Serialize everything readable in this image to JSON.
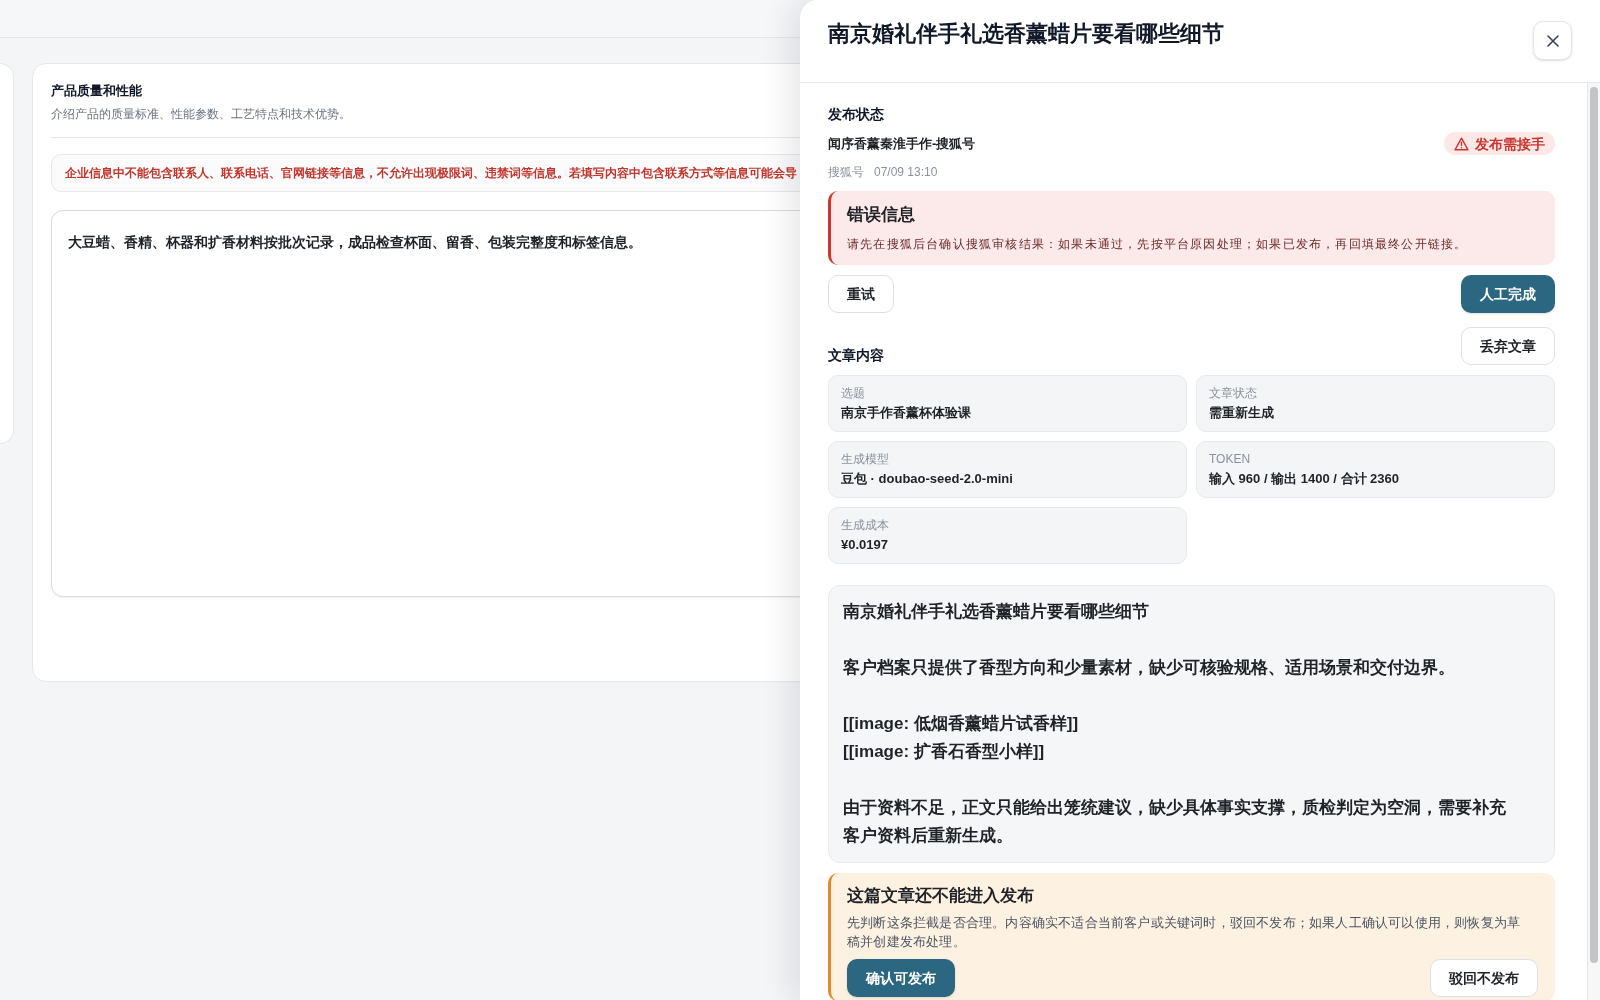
{
  "page": {
    "section": {
      "title": "产品质量和性能",
      "description": "介绍产品的质量标准、性能参数、工艺特点和技术优势。",
      "notice": "企业信息中不能包含联系人、联系电话、官网链接等信息，不允许出现极限词、违禁词等信息。若填写内容中包含联系方式等信息可能会导",
      "field_value": "大豆蜡、香精、杯器和扩香材料按批次记录，成品检查杯面、留香、包装完整度和标签信息。"
    }
  },
  "drawer": {
    "title": "南京婚礼伴手礼选香薰蜡片要看哪些细节",
    "publish_status": {
      "heading": "发布状态",
      "account": "闻序香薰秦淮手作-搜狐号",
      "badge": {
        "label": "发布需接手",
        "kind": "warning"
      },
      "platform": "搜狐号",
      "time": "07/09 13:10",
      "error": {
        "title": "错误信息",
        "message": "请先在搜狐后台确认搜狐审核结果：如果未通过，先按平台原因处理；如果已发布，再回填最终公开链接。"
      },
      "actions": [
        {
          "label": "重试",
          "kind": "secondary"
        },
        {
          "label": "人工完成",
          "kind": "primary"
        },
        {
          "label": "丢弃文章",
          "kind": "secondary"
        }
      ]
    },
    "article": {
      "heading": "文章内容",
      "fields": [
        {
          "label": "选题",
          "value": "南京手作香薰杯体验课"
        },
        {
          "label": "文章状态",
          "value": "需重新生成"
        },
        {
          "label": "生成模型",
          "value": "豆包 · doubao-seed-2.0-mini"
        },
        {
          "label": "TOKEN",
          "value": "输入 960 / 输出 1400 / 合计 2360"
        },
        {
          "label": "生成成本",
          "value": "¥0.0197"
        }
      ],
      "paragraphs": [
        [
          "南京婚礼伴手礼选香薰蜡片要看哪些细节"
        ],
        [
          "客户档案只提供了香型方向和少量素材，缺少可核验规格、适用场景和交付边界。"
        ],
        [
          "[[image: 低烟香薰蜡片试香样]]",
          "[[image: 扩香石香型小样]]"
        ],
        [
          "由于资料不足，正文只能给出笼统建议，缺少具体事实支撑，质检判定为空洞，需要补充客户资料后重新生成。"
        ]
      ]
    },
    "review": {
      "title": "这篇文章还不能进入发布",
      "message": "先判断这条拦截是否合理。内容确实不适合当前客户或关键词时，驳回不发布；如果人工确认可以使用，则恢复为草稿并创建发布处理。",
      "actions": [
        {
          "label": "确认可发布",
          "kind": "primary"
        },
        {
          "label": "驳回不发布",
          "kind": "secondary"
        }
      ]
    }
  }
}
